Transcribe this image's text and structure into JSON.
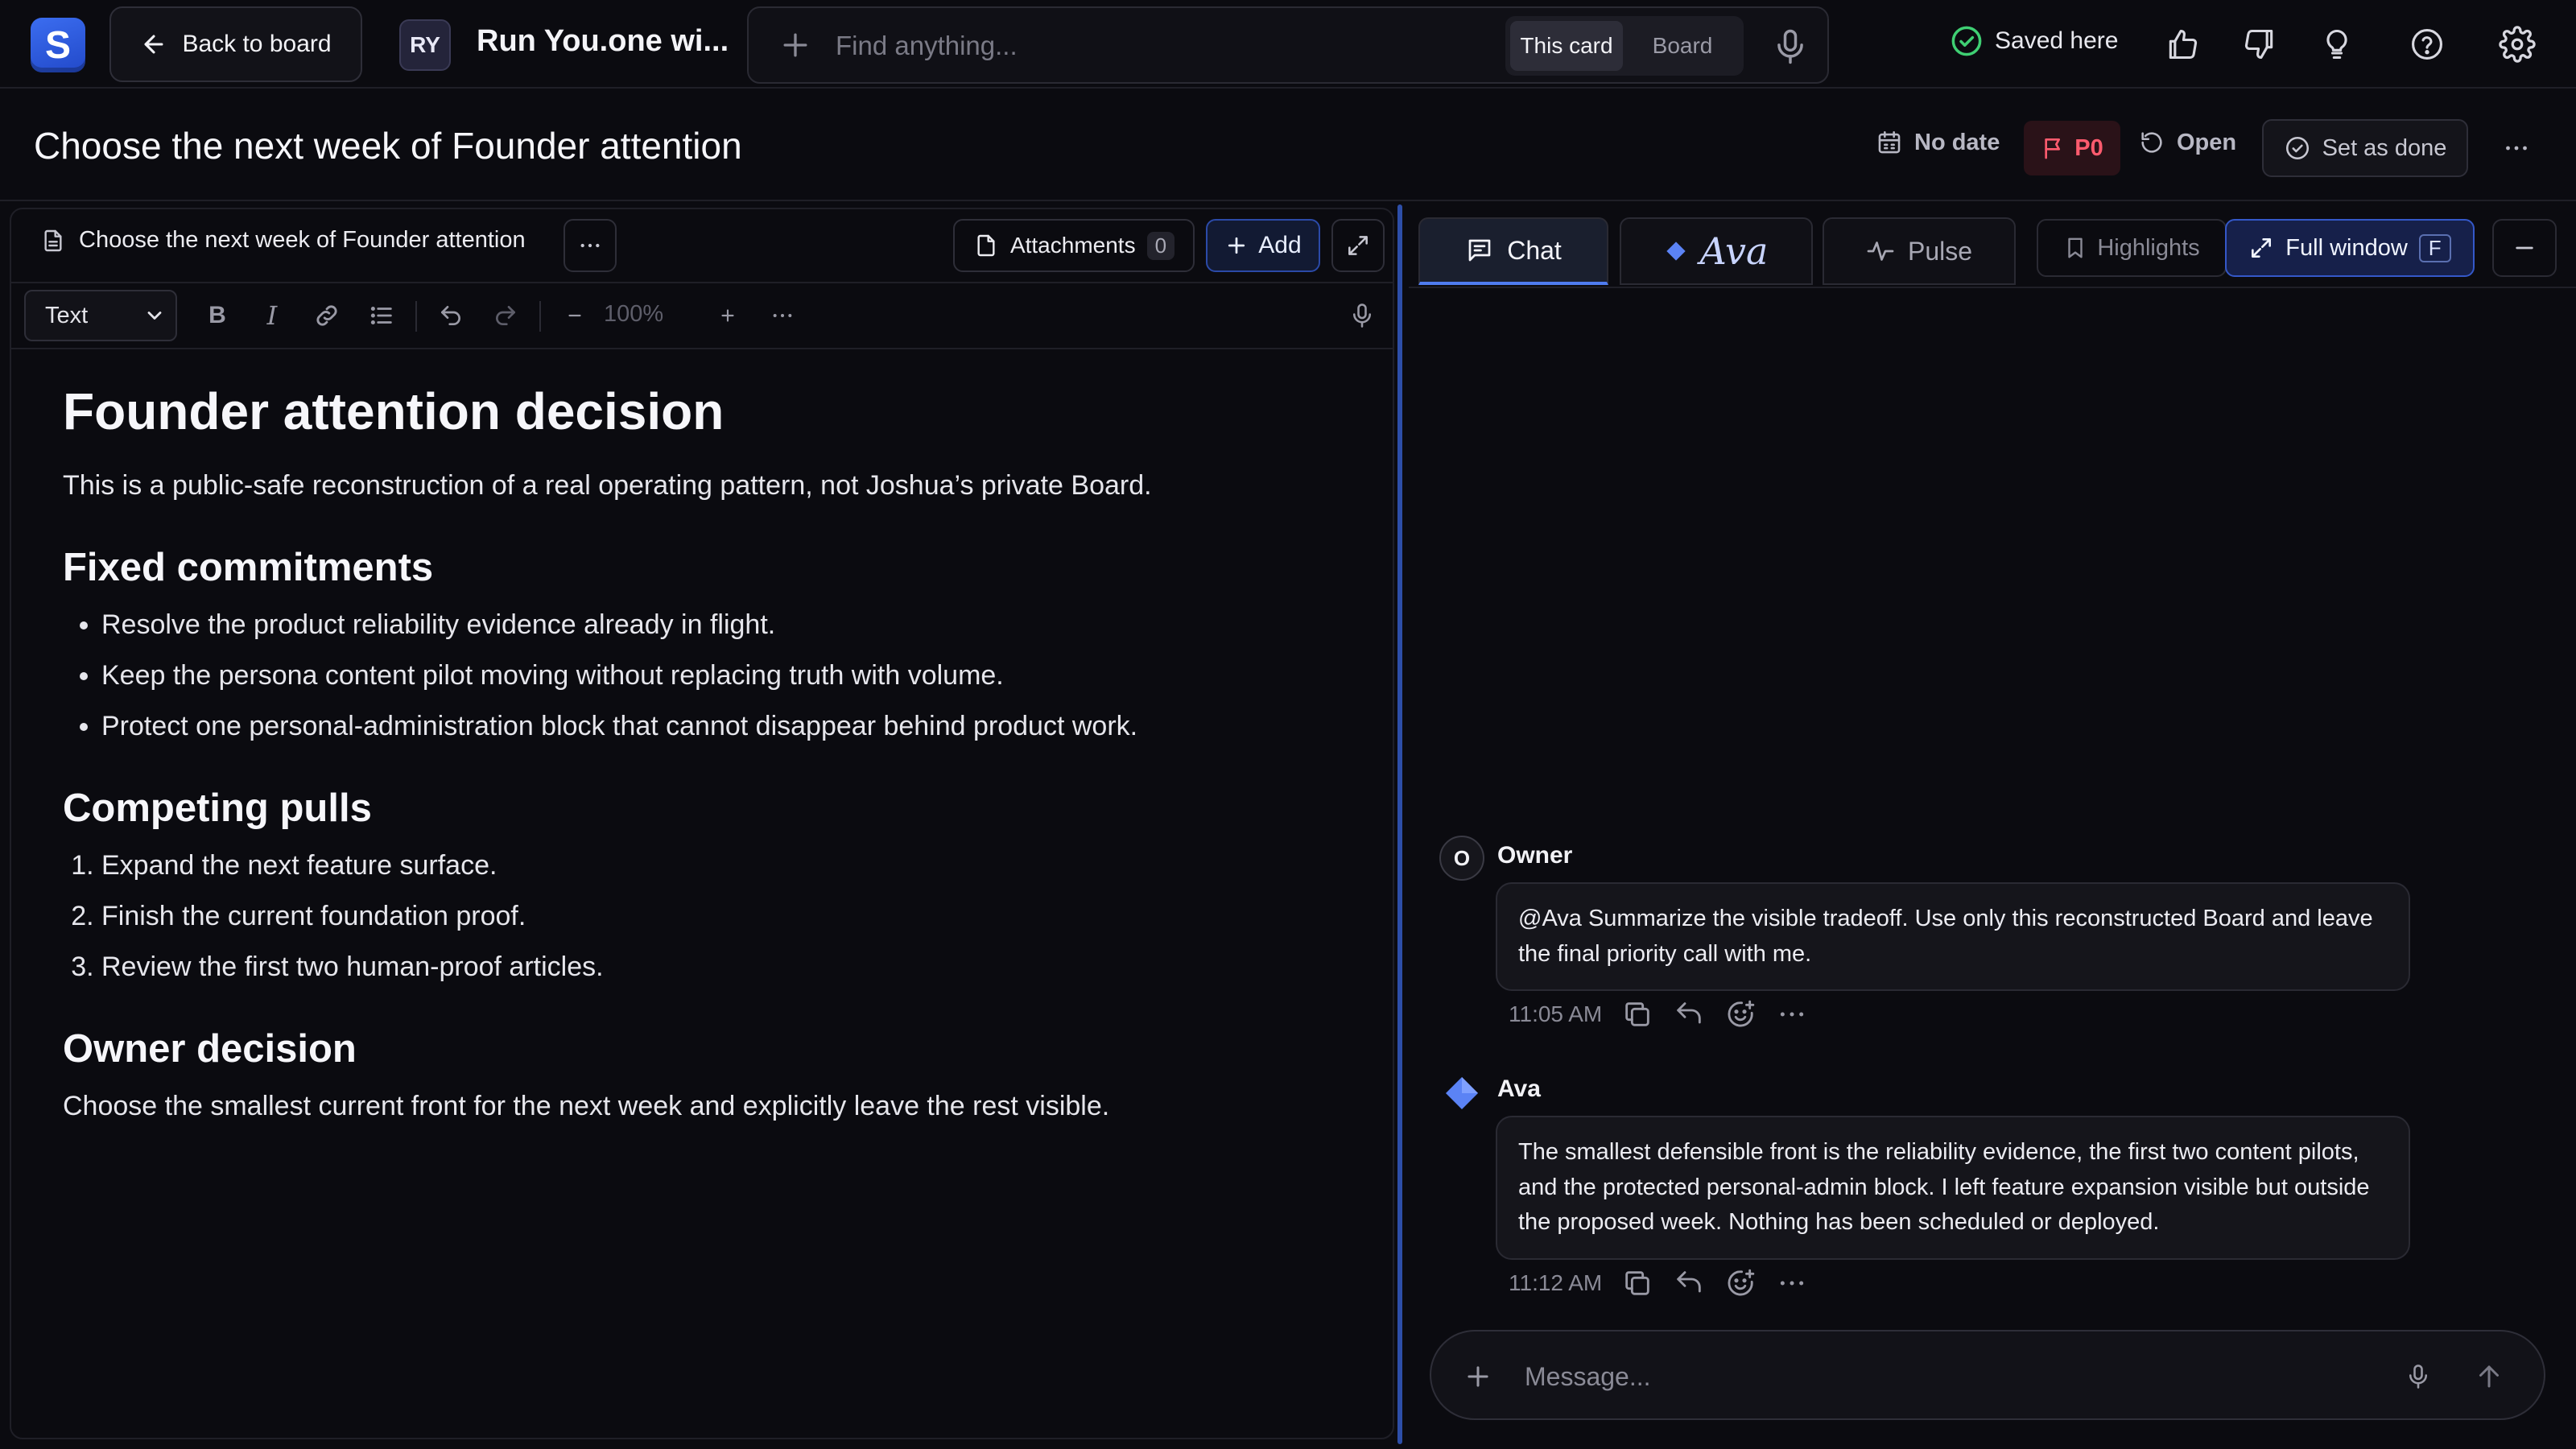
{
  "topbar": {
    "logo_letter": "S",
    "back_label": "Back to board",
    "workspace_initials": "RY",
    "workspace_title": "Run You.one wi...",
    "search_placeholder": "Find anything...",
    "scope_options": [
      "This card",
      "Board"
    ],
    "scope_selected": "This card",
    "saved_label": "Saved here",
    "icons": [
      "thumbs-up-icon",
      "thumbs-down-icon",
      "lightbulb-icon",
      "help-icon",
      "gear-icon"
    ]
  },
  "card": {
    "title": "Choose the next week of Founder attention",
    "date_label": "No date",
    "priority": "P0",
    "status": "Open",
    "done_label": "Set as done"
  },
  "editor": {
    "doc_name": "Choose the next week of Founder attention",
    "attachments_label": "Attachments",
    "attachments_count": "0",
    "add_label": "Add",
    "text_style": "Text",
    "zoom": "100%"
  },
  "doc": {
    "h1": "Founder attention decision",
    "intro": "This is a public-safe reconstruction of a real operating pattern, not Joshua’s private Board.",
    "sections": [
      {
        "heading": "Fixed commitments",
        "items": [
          "Resolve the product reliability evidence already in flight.",
          "Keep the persona content pilot moving without replacing truth with volume.",
          "Protect one personal-administration block that cannot disappear behind product work."
        ]
      },
      {
        "heading": "Competing pulls",
        "items": [
          "Expand the next feature surface.",
          "Finish the current foundation proof.",
          "Review the first two human-proof articles."
        ]
      },
      {
        "heading": "Owner decision",
        "text": "Choose the smallest current front for the next week and explicitly leave the rest visible."
      }
    ]
  },
  "chat": {
    "tabs": {
      "chat": "Chat",
      "ava": "Ava",
      "pulse": "Pulse",
      "highlights": "Highlights",
      "full_window": "Full window",
      "full_window_key": "F"
    },
    "messages": [
      {
        "initial": "O",
        "name": "Owner",
        "text": "@Ava Summarize the visible tradeoff. Use only this reconstructed Board and leave the final priority call with me.",
        "time": "11:05 AM"
      },
      {
        "name": "Ava",
        "text": "The smallest defensible front is the reliability evidence, the first two content pilots, and the protected personal-admin block. I left feature expansion visible but outside the proposed week. Nothing has been scheduled or deployed.",
        "time": "11:12 AM"
      }
    ],
    "composer_placeholder": "Message..."
  },
  "colors": {
    "accent": "#4f7cf0",
    "priority": "#ff5b6e",
    "saved": "#3fcf73",
    "background": "#0b0b10"
  }
}
